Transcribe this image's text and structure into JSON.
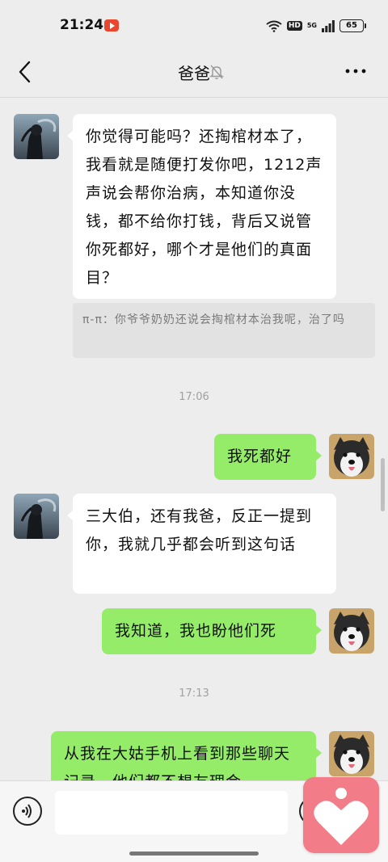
{
  "status_bar": {
    "time": "21:24",
    "hd": "HD",
    "signal": "5G",
    "battery": "65"
  },
  "nav": {
    "title": "爸爸",
    "icons": [
      "back-icon",
      "mute-bell-icon",
      "more-icon"
    ]
  },
  "messages": [
    {
      "side": "recv",
      "text": "你觉得可能吗？还掏棺材本了，我看就是随便打发你吧，1212声声说会帮你治病，本知道你没钱，都不给你打钱，背后又说管你死都好，哪个才是他们的真面目？"
    },
    {
      "side": "recv",
      "text": "三大伯，还有我爸，反正一提到你，我就几乎都会听到这句话"
    },
    {
      "side": "sent",
      "text": "我死都好"
    },
    {
      "side": "sent",
      "text": "我知道，我也盼他们死"
    },
    {
      "side": "sent",
      "text": "从我在大姑手机上看到那些聊天记录，他们都不想友理会"
    }
  ],
  "quote": {
    "text": "π-π：你爷爷奶奶还说会掏棺材本治我呢，治了吗"
  },
  "timestamps": [
    "17:06",
    "17:13"
  ],
  "input_bar": {
    "placeholder": "",
    "icons": [
      "voice-icon",
      "emoji-icon"
    ]
  },
  "colors": {
    "background": "#ededed",
    "sent_bubble": "#95ec69",
    "recv_bubble": "#ffffff",
    "floating_widget": "#f27c87"
  }
}
